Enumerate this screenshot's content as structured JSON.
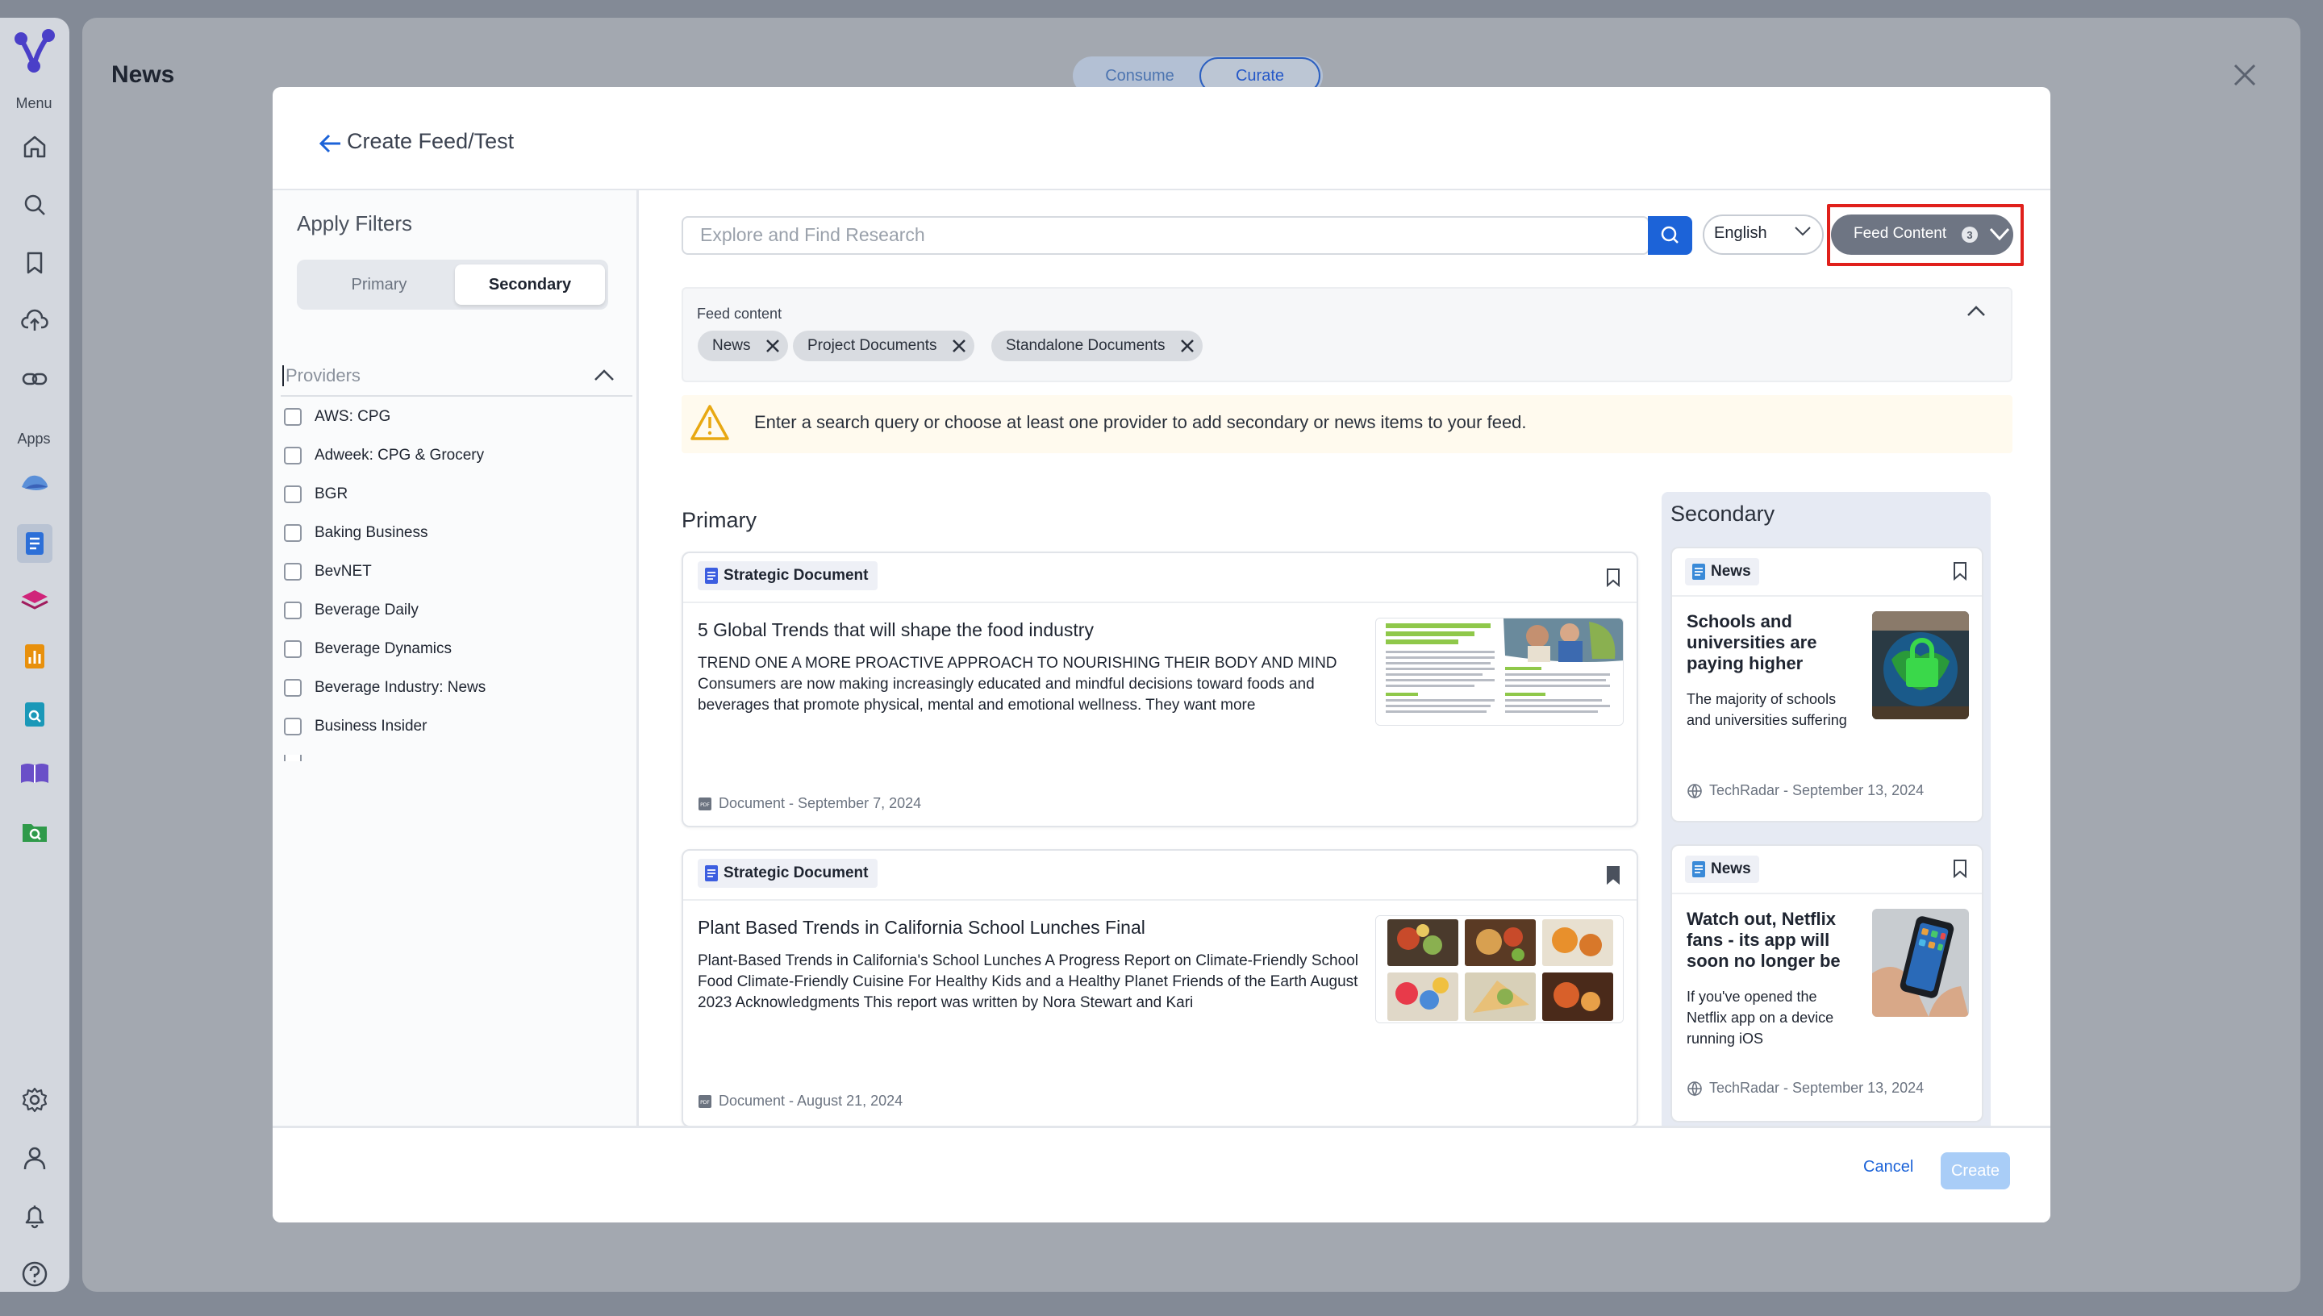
{
  "sidebar": {
    "menu_label": "Menu",
    "apps_label": "Apps",
    "icons": [
      "logo-icon",
      "home-icon",
      "search-icon",
      "bookmark-icon",
      "upload-icon",
      "link-icon",
      "app-chart-icon",
      "app-document-icon",
      "app-layers-icon",
      "app-bar-chart-icon",
      "app-doc-search-icon",
      "app-book-icon",
      "app-folder-search-icon",
      "settings-icon",
      "user-icon",
      "bell-icon",
      "help-icon"
    ]
  },
  "background": {
    "title": "News",
    "tabs": [
      "Consume",
      "Curate"
    ],
    "active_tab": "Curate"
  },
  "modal": {
    "title": "Create Feed/Test",
    "filters": {
      "title": "Apply Filters",
      "segments": [
        "Primary",
        "Secondary"
      ],
      "active_segment": "Secondary",
      "providers_label": "Providers",
      "providers": [
        "AWS: CPG",
        "Adweek: CPG & Grocery",
        "BGR",
        "Baking Business",
        "BevNET",
        "Beverage Daily",
        "Beverage Dynamics",
        "Beverage Industry: News",
        "Business Insider"
      ]
    },
    "search": {
      "placeholder": "Explore and Find Research"
    },
    "language": "English",
    "feed_content_button": {
      "label": "Feed Content",
      "count": "3"
    },
    "feed_content_panel": {
      "label": "Feed content",
      "chips": [
        "News",
        "Project Documents",
        "Standalone Documents"
      ]
    },
    "warning": "Enter a search query or choose at least one provider to add secondary or news items to your feed.",
    "primary": {
      "heading": "Primary",
      "cards": [
        {
          "tag": "Strategic Document",
          "title": "5 Global Trends that will shape the food industry",
          "body": "TREND ONE A MORE PROACTIVE APPROACH TO NOURISHING THEIR BODY AND MIND Consumers are now making increasingly educated and mindful decisions toward foods and beverages that promote physical, mental and emotional wellness. They want more",
          "meta": "Document - September 7, 2024",
          "bookmarked": false
        },
        {
          "tag": "Strategic Document",
          "title": "Plant Based Trends in California School Lunches Final",
          "body": "Plant-Based Trends in California's School Lunches A Progress Report on Climate-Friendly School Food Climate-Friendly Cuisine For Healthy Kids and a Healthy Planet Friends of the Earth August 2023 Acknowledgments This report was written by Nora Stewart and Kari",
          "meta": "Document - August 21, 2024",
          "bookmarked": true
        }
      ]
    },
    "secondary": {
      "heading": "Secondary",
      "cards": [
        {
          "tag": "News",
          "title": "Schools and universities are paying higher",
          "body": "The majority of schools and universities suffering",
          "meta": "TechRadar - September 13, 2024"
        },
        {
          "tag": "News",
          "title": "Watch out, Netflix fans - its app will soon no longer be",
          "body": "If you've opened the Netflix app on a device running iOS",
          "meta": "TechRadar - September 13, 2024"
        }
      ]
    },
    "footer": {
      "cancel": "Cancel",
      "create": "Create"
    }
  },
  "colors": {
    "accent": "#1c63d8",
    "highlight": "#e0201b",
    "create_disabled": "#a9cdf7"
  }
}
